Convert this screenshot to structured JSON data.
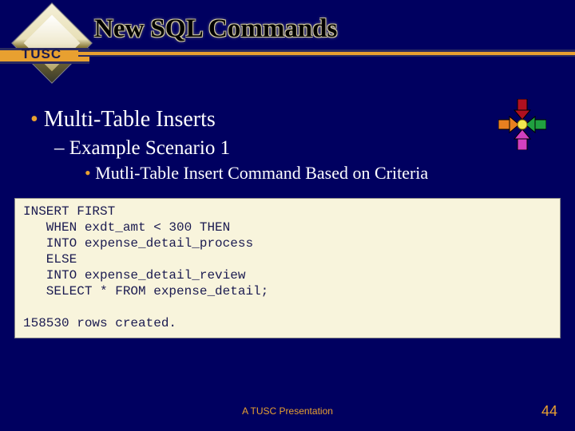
{
  "logo_label": "TUSC",
  "title": "New SQL Commands",
  "bullets": {
    "level1": "Multi-Table Inserts",
    "level2": "Example Scenario 1",
    "level3": "Mutli-Table Insert Command Based on Criteria"
  },
  "code": "INSERT FIRST\n   WHEN exdt_amt < 300 THEN\n   INTO expense_detail_process\n   ELSE\n   INTO expense_detail_review\n   SELECT * FROM expense_detail;\n\n158530 rows created.",
  "footer": "A TUSC Presentation",
  "page_number": "44",
  "arrow_colors": {
    "top": "#b01020",
    "left": "#e88020",
    "right": "#20a040",
    "bottom": "#d040c0",
    "center": "#f0e850"
  }
}
